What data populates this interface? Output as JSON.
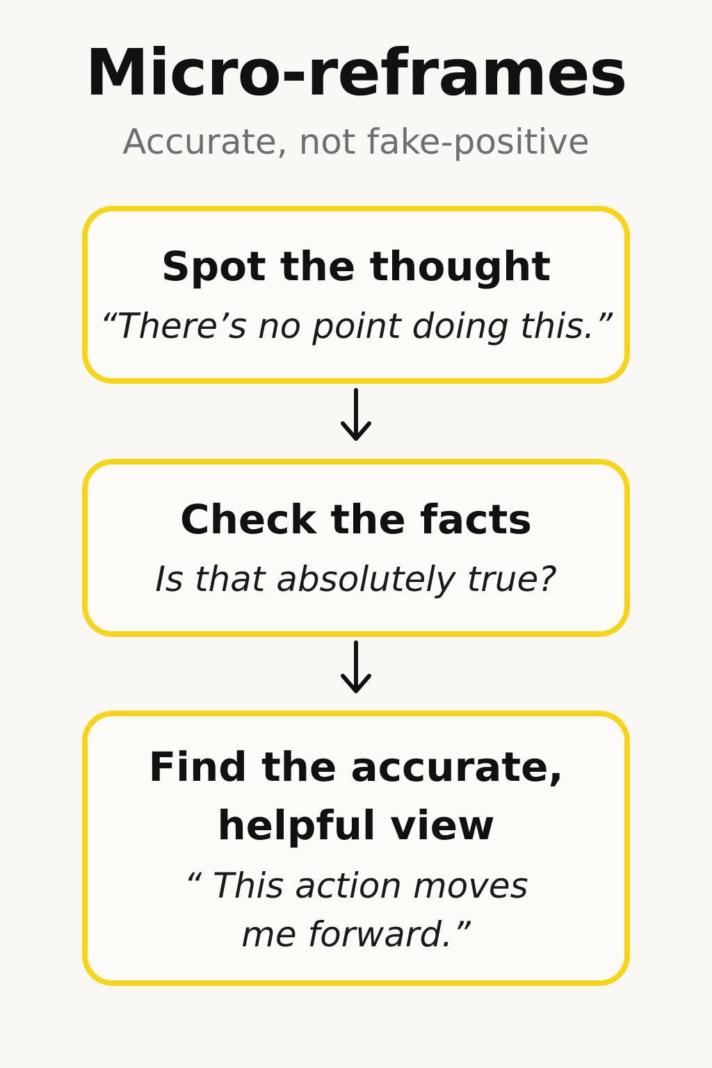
{
  "header": {
    "title": "Micro-reframes",
    "subtitle": "Accurate, not fake-positive"
  },
  "steps": [
    {
      "heading": "Spot the thought",
      "quote": "“There’s no point doing this.”"
    },
    {
      "heading": "Check the facts",
      "quote": "Is that absolutely true?"
    },
    {
      "heading": "Find the accurate, helpful view",
      "quote": "“ This action moves me forward.”"
    }
  ],
  "colors": {
    "background": "#f9f8f4",
    "box_border": "#f7d417",
    "text": "#111111",
    "subtitle": "#6e6e6e"
  },
  "icons": [
    "arrow-down-icon",
    "arrow-down-icon"
  ]
}
